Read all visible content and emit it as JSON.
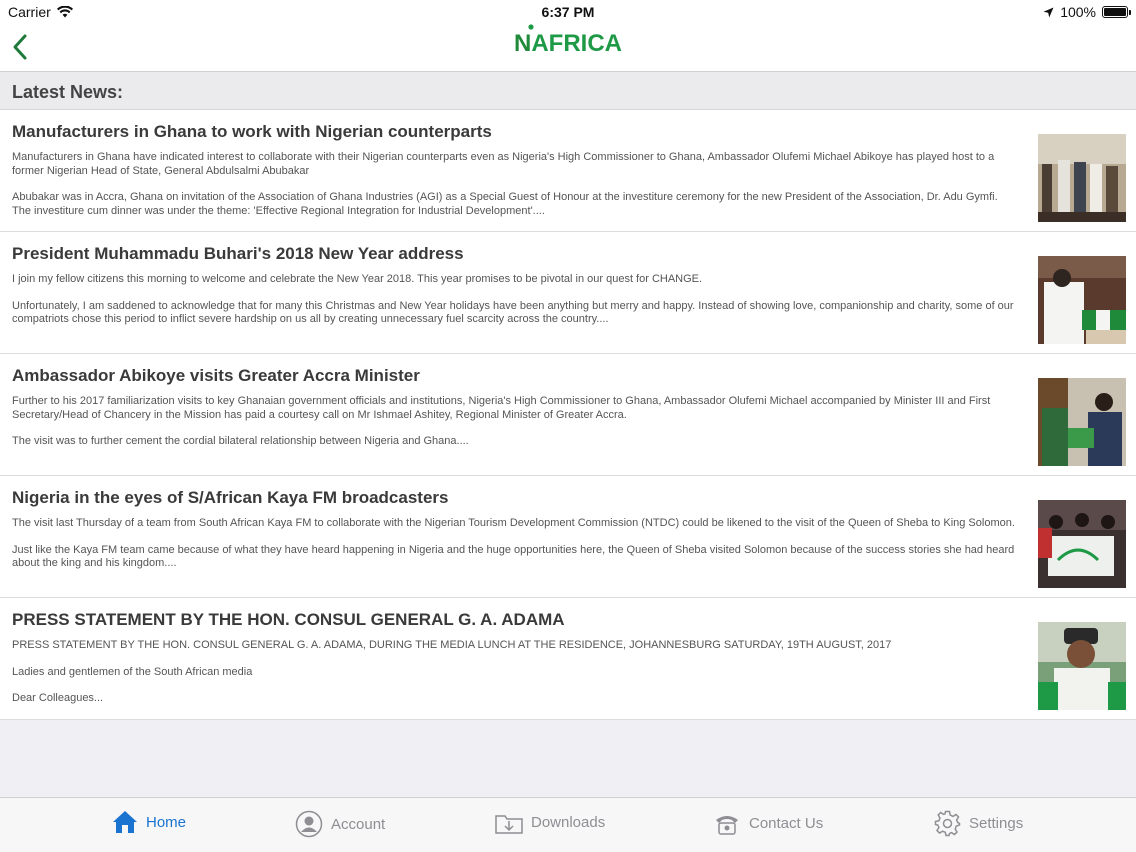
{
  "status_bar": {
    "carrier": "Carrier",
    "time": "6:37 PM",
    "battery": "100%",
    "wifi_icon": "wifi-icon",
    "location_icon": "location-arrow-icon"
  },
  "nav": {
    "back_icon": "chevron-left-icon",
    "logo_text_n": "N",
    "logo_text_rest": "AFRICA"
  },
  "section": {
    "title": "Latest News:"
  },
  "news": [
    {
      "title": "Manufacturers in Ghana to work with Nigerian counterparts",
      "para1": "Manufacturers in Ghana have indicated interest to collaborate with their Nigerian counterparts even as Nigeria's High Commissioner to Ghana, Ambassador Olufemi Michael Abikoye has played host to a former Nigerian Head of State, General Abdulsalmi Abubakar",
      "para2": "Abubakar was in Accra, Ghana on invitation of the Association of Ghana Industries (AGI) as a Special Guest of Honour at the investiture ceremony for the new President of the Association, Dr. Adu Gymfi. The investiture cum dinner was under the theme: 'Effective Regional Integration for Industrial Development'....",
      "para3": ""
    },
    {
      "title": "President Muhammadu Buhari's 2018 New Year address",
      "para1": "I join my fellow citizens this morning to welcome and celebrate the New Year 2018. This year promises to be pivotal in our quest for CHANGE.",
      "para2": " Unfortunately, I am saddened to acknowledge that for many this Christmas and New Year holidays have been anything but merry and happy. Instead of showing love, companionship and charity, some of our compatriots chose this period to inflict severe hardship on us all by creating unnecessary fuel scarcity across the country....",
      "para3": ""
    },
    {
      "title": "Ambassador Abikoye visits Greater Accra Minister",
      "para1": "Further to his 2017 familiarization visits to key Ghanaian government officials and institutions, Nigeria's High Commissioner to Ghana, Ambassador Olufemi Michael accompanied by Minister III and First Secretary/Head of Chancery in the Mission has paid a courtesy call on Mr Ishmael Ashitey, Regional Minister of Greater Accra.",
      "para2": "The visit was to further cement the cordial bilateral relationship between Nigeria and Ghana....",
      "para3": ""
    },
    {
      "title": "Nigeria in the eyes of S/African Kaya FM broadcasters",
      "para1": "The visit last Thursday of a team from South African Kaya FM to collaborate with the Nigerian Tourism Development Commission (NTDC) could be likened to the visit of the Queen of Sheba to King Solomon.",
      "para2": "Just like the Kaya FM team came because of what they have heard happening in Nigeria and the huge opportunities here, the Queen of Sheba visited Solomon because of the success stories she had heard about the king and his kingdom....",
      "para3": ""
    },
    {
      "title": "PRESS STATEMENT BY THE HON. CONSUL GENERAL G. A. ADAMA",
      "para1": "PRESS STATEMENT BY THE HON. CONSUL GENERAL G. A. ADAMA, DURING THE MEDIA LUNCH AT THE RESIDENCE, JOHANNESBURG SATURDAY, 19TH AUGUST, 2017",
      "para2": "Ladies and gentlemen of the South African media",
      "para3": "Dear Colleagues..."
    }
  ],
  "tabs": [
    {
      "label": "Home",
      "icon": "home-icon",
      "active": true
    },
    {
      "label": "Account",
      "icon": "account-icon",
      "active": false
    },
    {
      "label": "Downloads",
      "icon": "downloads-icon",
      "active": false
    },
    {
      "label": "Contact Us",
      "icon": "phone-icon",
      "active": false
    },
    {
      "label": "Settings",
      "icon": "gear-icon",
      "active": false
    }
  ],
  "colors": {
    "accent": "#1a73d0",
    "brand_green": "#1e9a46",
    "inactive": "#8e8e93"
  }
}
